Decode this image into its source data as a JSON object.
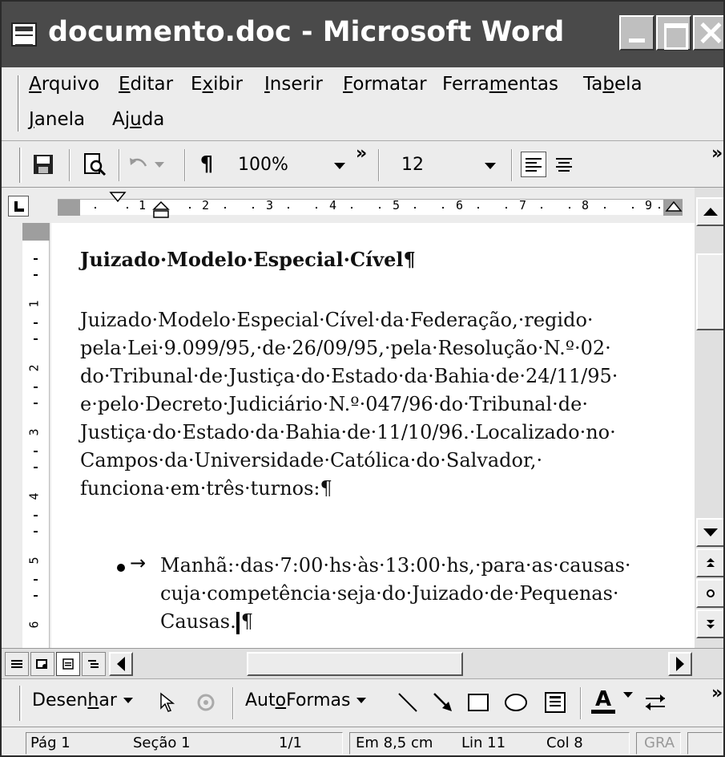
{
  "window": {
    "title": "documento.doc - Microsoft Word"
  },
  "menu": {
    "row1": [
      {
        "pre": "",
        "key": "A",
        "post": "rquivo"
      },
      {
        "pre": "",
        "key": "E",
        "post": "ditar"
      },
      {
        "pre": "E",
        "key": "x",
        "post": "ibir"
      },
      {
        "pre": "",
        "key": "I",
        "post": "nserir"
      },
      {
        "pre": "",
        "key": "F",
        "post": "ormatar"
      },
      {
        "pre": "Ferra",
        "key": "m",
        "post": "entas"
      },
      {
        "pre": "Ta",
        "key": "b",
        "post": "ela"
      }
    ],
    "row2": [
      {
        "pre": "",
        "key": "J",
        "post": "anela"
      },
      {
        "pre": "Aj",
        "key": "u",
        "post": "da"
      }
    ]
  },
  "toolbar": {
    "zoom": "100%",
    "font_size": "12",
    "pilcrow": "¶",
    "overflow": "»"
  },
  "ruler": {
    "h_numbers": [
      "1",
      "2",
      "3",
      "4",
      "5",
      "6",
      "7",
      "8",
      "9"
    ],
    "v_numbers": [
      "1",
      "2",
      "3",
      "4",
      "5",
      "6"
    ]
  },
  "document": {
    "heading": "Juizado·Modelo·Especial·Cível¶",
    "paragraph_lines": [
      "Juizado·Modelo·Especial·Cível·da·Federação,·regido·",
      "pela·Lei·9.099/95,·de·26/09/95,·pela·Resolução·N.º·02·",
      "do·Tribunal·de·Justiça·do·Estado·da·Bahia·de·24/11/95·",
      "e·pelo·Decreto·Judiciário·N.º·047/96·do·Tribunal·de·",
      "Justiça·do·Estado·da·Bahia·de·11/10/96.·Localizado·no·",
      "Campos·da·Universidade·Católica·do·Salvador,·",
      "funciona·em·três·turnos:¶"
    ],
    "bullet_arrow": "→",
    "bullet_lines": [
      "Manhã:·das·7:00·hs·às·13:00·hs,·para·as·causas·",
      "cuja·competência·seja·do·Juizado·de·Pequenas·",
      "Causas."
    ],
    "bullet_end_mark": "¶"
  },
  "drawing_toolbar": {
    "draw_pre": "Desen",
    "draw_key": "h",
    "draw_post": "ar",
    "autoshapes_pre": "Aut",
    "autoshapes_key": "o",
    "autoshapes_post": "Formas",
    "font_color_letter": "A",
    "overflow": "»"
  },
  "status": {
    "page": "Pág 1",
    "section": "Seção 1",
    "page_count": "1/1",
    "position": "Em 8,5 cm",
    "line": "Lin 11",
    "column": "Col 8",
    "rec": "GRA"
  }
}
